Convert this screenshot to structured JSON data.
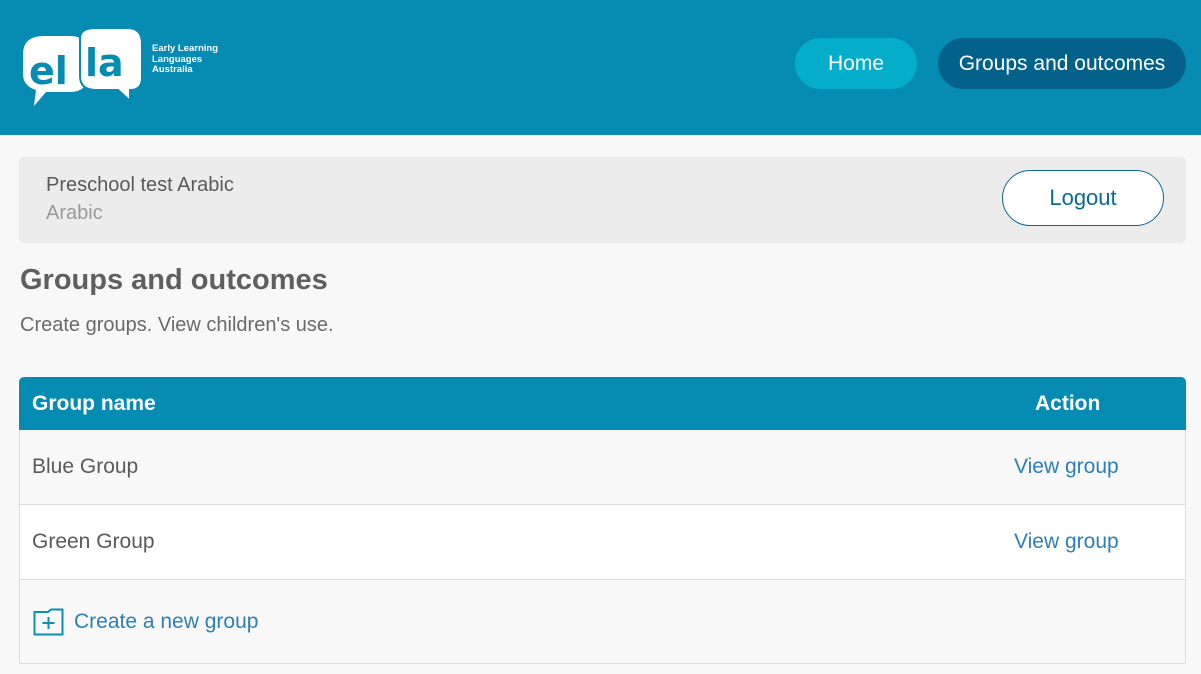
{
  "brand": {
    "logo_mark": "ella",
    "logo_lines": [
      "Early Learning",
      "Languages",
      "Australia"
    ],
    "primary_color": "#068bb2",
    "dark_color": "#04618a",
    "light_color": "#04aecb",
    "link_color": "#2f7fb7"
  },
  "nav": {
    "home_label": "Home",
    "groups_label": "Groups and outcomes"
  },
  "user": {
    "name": "Preschool test Arabic",
    "language": "Arabic",
    "logout_label": "Logout"
  },
  "page": {
    "title": "Groups and outcomes",
    "subtitle": "Create groups. View children's use."
  },
  "table": {
    "headers": {
      "name": "Group name",
      "action": "Action"
    },
    "rows": [
      {
        "name": "Blue Group",
        "action": "View group"
      },
      {
        "name": "Green Group",
        "action": "View group"
      }
    ],
    "create_label": "Create a new group",
    "create_icon": "folder-plus-icon"
  }
}
